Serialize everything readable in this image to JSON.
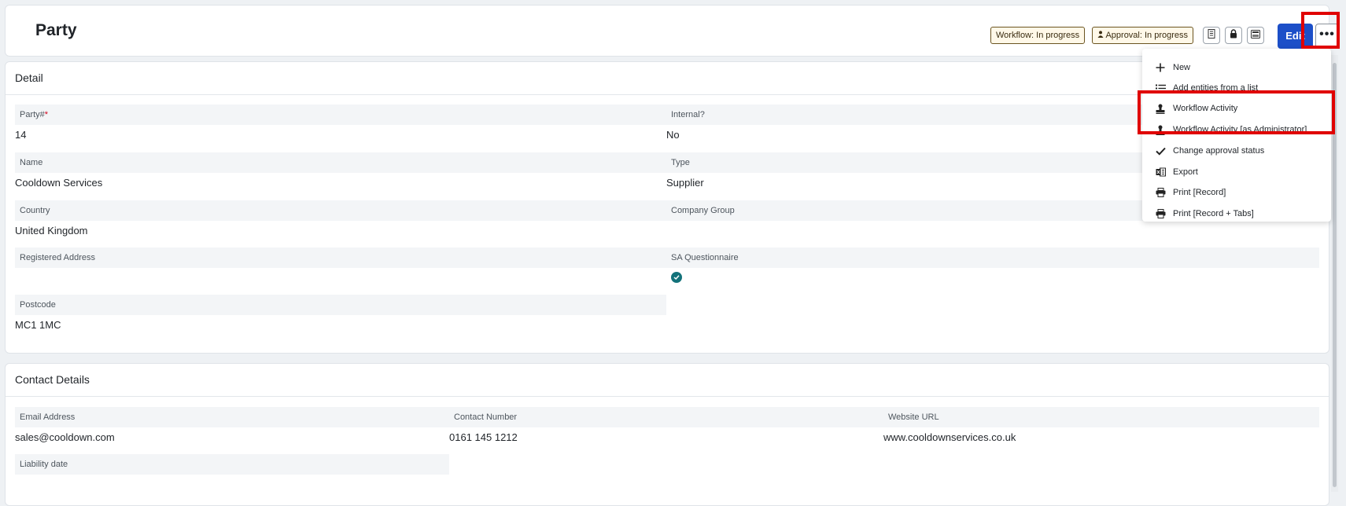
{
  "header": {
    "title": "Party",
    "workflow_badge": "Workflow: In progress",
    "approval_badge": "Approval: In progress",
    "edit_label": "Edit",
    "more_label": "•••"
  },
  "detail": {
    "title": "Detail",
    "fields": {
      "party_no": {
        "label": "Party#",
        "value": "14"
      },
      "internal": {
        "label": "Internal?",
        "value": "No"
      },
      "name": {
        "label": "Name",
        "value": "Cooldown Services"
      },
      "type": {
        "label": "Type",
        "value": "Supplier"
      },
      "country": {
        "label": "Country",
        "value": "United Kingdom"
      },
      "company_group": {
        "label": "Company Group",
        "value": ""
      },
      "registered_address": {
        "label": "Registered Address",
        "value": ""
      },
      "sa_questionnaire": {
        "label": "SA Questionnaire",
        "checked": true
      },
      "postcode": {
        "label": "Postcode",
        "value": "MC1 1MC"
      }
    }
  },
  "contact": {
    "title": "Contact Details",
    "fields": {
      "email": {
        "label": "Email Address",
        "value": "sales@cooldown.com"
      },
      "phone": {
        "label": "Contact Number",
        "value": "0161 145 1212"
      },
      "website": {
        "label": "Website URL",
        "value": "www.cooldownservices.co.uk"
      },
      "liability": {
        "label": "Liability date",
        "value": ""
      }
    }
  },
  "menu": {
    "items": [
      {
        "label": "New",
        "icon": "plus-icon"
      },
      {
        "label": "Add entities from a list",
        "icon": "list-icon"
      },
      {
        "label": "Workflow Activity",
        "icon": "stamp-icon"
      },
      {
        "label": "Workflow Activity [as Administrator]",
        "icon": "stamp-icon"
      },
      {
        "label": "Change approval status",
        "icon": "check-icon"
      },
      {
        "label": "Export",
        "icon": "excel-icon"
      },
      {
        "label": "Print [Record]",
        "icon": "printer-icon"
      },
      {
        "label": "Print [Record + Tabs]",
        "icon": "printer-icon"
      }
    ]
  },
  "colors": {
    "primary": "#1c4fc8",
    "highlight": "#e00000",
    "check": "#13727a",
    "badge_bg": "#fff8e8"
  }
}
